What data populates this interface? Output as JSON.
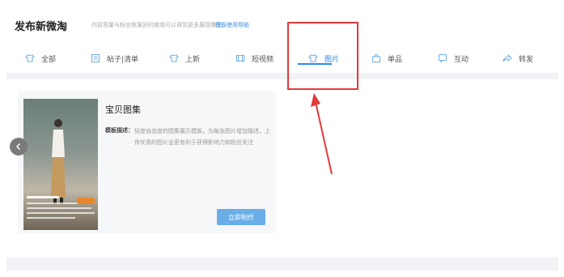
{
  "header": {
    "title": "发布新微淘",
    "subtitle": "内容质量与粉丝效果好的微淘可以得到更多展现曝光",
    "help_link": "模板使用帮助"
  },
  "tabs": [
    {
      "label": "全部",
      "icon": "shirt-icon"
    },
    {
      "label": "帖子|清单",
      "icon": "list-icon"
    },
    {
      "label": "上新",
      "icon": "shirt-icon"
    },
    {
      "label": "短视频",
      "icon": "video-icon"
    },
    {
      "label": "图片",
      "icon": "shirt-icon",
      "active": true
    },
    {
      "label": "单品",
      "icon": "bag-icon"
    },
    {
      "label": "互动",
      "icon": "chat-icon"
    },
    {
      "label": "转发",
      "icon": "share-icon"
    }
  ],
  "card": {
    "title": "宝贝图集",
    "desc_label": "模板描述：",
    "desc": "轻度自由度的图集展示模板，为每张图片增加描述，上传优质的图片会更有利于获得影响力和粉丝关注",
    "button": "立即制作"
  },
  "colors": {
    "accent": "#2d8cf0",
    "highlight": "#e33a3a",
    "button": "#6aaee8"
  }
}
